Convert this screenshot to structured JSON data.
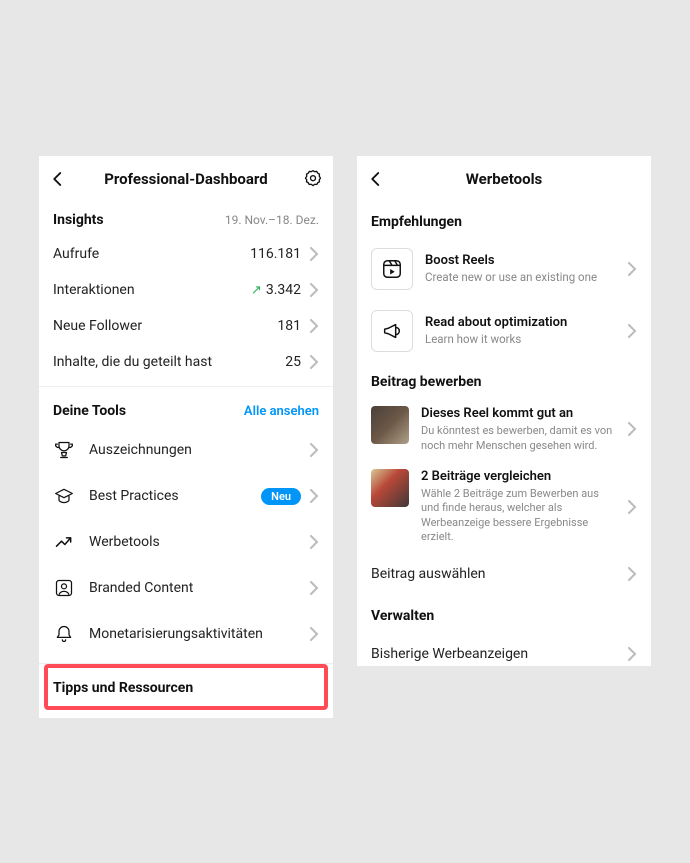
{
  "left": {
    "title": "Professional-Dashboard",
    "insights": {
      "heading": "Insights",
      "dateRange": "19. Nov.–18. Dez.",
      "rows": [
        {
          "label": "Aufrufe",
          "value": "116.181",
          "trend": false
        },
        {
          "label": "Interaktionen",
          "value": "3.342",
          "trend": true
        },
        {
          "label": "Neue Follower",
          "value": "181",
          "trend": false
        },
        {
          "label": "Inhalte, die du geteilt hast",
          "value": "25",
          "trend": false
        }
      ]
    },
    "tools": {
      "heading": "Deine Tools",
      "seeAll": "Alle ansehen",
      "items": [
        {
          "label": "Auszeichnungen",
          "icon": "trophy"
        },
        {
          "label": "Best Practices",
          "icon": "grad",
          "badge": "Neu"
        },
        {
          "label": "Werbetools",
          "icon": "trend"
        },
        {
          "label": "Branded Content",
          "icon": "brand"
        },
        {
          "label": "Monetarisierungsaktivitäten",
          "icon": "bell"
        }
      ]
    },
    "tips": {
      "heading": "Tipps und Ressourcen"
    }
  },
  "right": {
    "title": "Werbetools",
    "recommendations": {
      "heading": "Empfehlungen",
      "items": [
        {
          "title": "Boost Reels",
          "sub": "Create new or use an existing one",
          "icon": "reels"
        },
        {
          "title": "Read about optimization",
          "sub": "Learn how it works",
          "icon": "megaphone"
        }
      ]
    },
    "promote": {
      "heading": "Beitrag bewerben",
      "items": [
        {
          "title": "Dieses Reel kommt gut an",
          "sub": "Du könntest es bewerben, damit es von noch mehr Menschen gesehen wird.",
          "thumb": "t1"
        },
        {
          "title": "2 Beiträge vergleichen",
          "sub": "Wähle 2 Beiträge zum Bewerben aus und finde heraus, welcher als Werbeanzeige bessere Ergebnisse erzielt.",
          "thumb": "t2"
        }
      ],
      "select": "Beitrag auswählen"
    },
    "manage": {
      "heading": "Verwalten",
      "items": [
        {
          "label": "Bisherige Werbeanzeigen"
        }
      ]
    }
  }
}
